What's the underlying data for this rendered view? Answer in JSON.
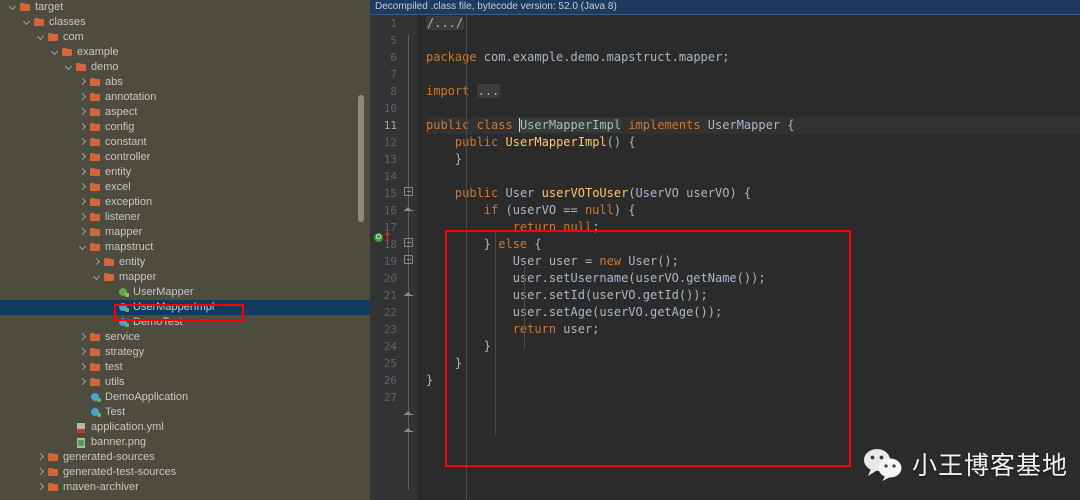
{
  "window": {
    "theme_bg_sidebar": "#4e4b3f",
    "theme_bg_editor": "#2b2b2b",
    "accent_red": "#ff0000",
    "selection_blue": "#123a5e"
  },
  "sidebar": {
    "name": "project-tree",
    "scrollbar_present": true,
    "items": [
      {
        "label": "target",
        "depth": 1,
        "type": "folder",
        "state": "expanded"
      },
      {
        "label": "classes",
        "depth": 2,
        "type": "folder",
        "state": "expanded"
      },
      {
        "label": "com",
        "depth": 3,
        "type": "folder",
        "state": "expanded"
      },
      {
        "label": "example",
        "depth": 4,
        "type": "folder",
        "state": "expanded"
      },
      {
        "label": "demo",
        "depth": 5,
        "type": "folder",
        "state": "expanded"
      },
      {
        "label": "abs",
        "depth": 6,
        "type": "folder",
        "state": "collapsed"
      },
      {
        "label": "annotation",
        "depth": 6,
        "type": "folder",
        "state": "collapsed"
      },
      {
        "label": "aspect",
        "depth": 6,
        "type": "folder",
        "state": "collapsed"
      },
      {
        "label": "config",
        "depth": 6,
        "type": "folder",
        "state": "collapsed"
      },
      {
        "label": "constant",
        "depth": 6,
        "type": "folder",
        "state": "collapsed"
      },
      {
        "label": "controller",
        "depth": 6,
        "type": "folder",
        "state": "collapsed"
      },
      {
        "label": "entity",
        "depth": 6,
        "type": "folder",
        "state": "collapsed"
      },
      {
        "label": "excel",
        "depth": 6,
        "type": "folder",
        "state": "collapsed"
      },
      {
        "label": "exception",
        "depth": 6,
        "type": "folder",
        "state": "collapsed"
      },
      {
        "label": "listener",
        "depth": 6,
        "type": "folder",
        "state": "collapsed"
      },
      {
        "label": "mapper",
        "depth": 6,
        "type": "folder",
        "state": "collapsed"
      },
      {
        "label": "mapstruct",
        "depth": 6,
        "type": "folder",
        "state": "expanded"
      },
      {
        "label": "entity",
        "depth": 7,
        "type": "folder",
        "state": "collapsed"
      },
      {
        "label": "mapper",
        "depth": 7,
        "type": "folder",
        "state": "expanded"
      },
      {
        "label": "UserMapper",
        "depth": 8,
        "type": "interface",
        "state": "none"
      },
      {
        "label": "UserMapperImpl",
        "depth": 8,
        "type": "class",
        "state": "none",
        "selected": true,
        "annotated": true
      },
      {
        "label": "DemoTest",
        "depth": 8,
        "type": "class",
        "state": "none"
      },
      {
        "label": "service",
        "depth": 6,
        "type": "folder",
        "state": "collapsed"
      },
      {
        "label": "strategy",
        "depth": 6,
        "type": "folder",
        "state": "collapsed"
      },
      {
        "label": "test",
        "depth": 6,
        "type": "folder",
        "state": "collapsed"
      },
      {
        "label": "utils",
        "depth": 6,
        "type": "folder",
        "state": "collapsed"
      },
      {
        "label": "DemoApplication",
        "depth": 6,
        "type": "class",
        "state": "none"
      },
      {
        "label": "Test",
        "depth": 6,
        "type": "class",
        "state": "none"
      },
      {
        "label": "application.yml",
        "depth": 5,
        "type": "yml",
        "state": "none"
      },
      {
        "label": "banner.png",
        "depth": 5,
        "type": "png",
        "state": "none"
      },
      {
        "label": "generated-sources",
        "depth": 3,
        "type": "folder",
        "state": "collapsed"
      },
      {
        "label": "generated-test-sources",
        "depth": 3,
        "type": "folder",
        "state": "collapsed"
      },
      {
        "label": "maven-archiver",
        "depth": 3,
        "type": "folder",
        "state": "collapsed"
      }
    ]
  },
  "editor": {
    "banner_text": "Decompiled .class file, bytecode version: 52.0 (Java 8)",
    "current_line_number": 11,
    "implementation_marker": "O",
    "lines": [
      {
        "num": "1",
        "html": "<span class=\"fold-chip\">/.../</span>"
      },
      {
        "num": "5",
        "html": ""
      },
      {
        "num": "6",
        "html": "<span class=\"kw\">package</span> com.example.demo.mapstruct.mapper;"
      },
      {
        "num": "7",
        "html": ""
      },
      {
        "num": "8",
        "html": "<span class=\"kw\">import</span> <span class=\"fold-chip\">...</span>"
      },
      {
        "num": "10",
        "html": ""
      },
      {
        "num": "11",
        "html": "<span class=\"kw\">public class</span> <span class=\"ident-hl\">UserMapperImpl</span> <span class=\"kw\">implements</span> UserMapper {",
        "current": true
      },
      {
        "num": "12",
        "html": "    <span class=\"kw\">public</span> <span class=\"mth\">UserMapperImpl</span>() {"
      },
      {
        "num": "13",
        "html": "    }"
      },
      {
        "num": "14",
        "html": ""
      },
      {
        "num": "15",
        "html": "    <span class=\"kw\">public</span> User <span class=\"mth\">userVOToUser</span>(UserVO userVO) {"
      },
      {
        "num": "16",
        "html": "        <span class=\"kw\">if</span> (userVO == <span class=\"kw\">null</span>) {"
      },
      {
        "num": "17",
        "html": "            <span class=\"kw\">return null</span>;"
      },
      {
        "num": "18",
        "html": "        } <span class=\"kw\">else</span> {"
      },
      {
        "num": "19",
        "html": "            User user = <span class=\"kw\">new</span> User();"
      },
      {
        "num": "20",
        "html": "            user.setUsername(userVO.getName());"
      },
      {
        "num": "21",
        "html": "            user.setId(userVO.getId());"
      },
      {
        "num": "22",
        "html": "            user.setAge(userVO.getAge());"
      },
      {
        "num": "23",
        "html": "            <span class=\"kw\">return</span> user;"
      },
      {
        "num": "24",
        "html": "        }"
      },
      {
        "num": "25",
        "html": "    }"
      },
      {
        "num": "26",
        "html": "}"
      },
      {
        "num": "27",
        "html": ""
      }
    ],
    "code_plain": [
      "/.../",
      "",
      "package com.example.demo.mapstruct.mapper;",
      "",
      "import ...",
      "",
      "public class UserMapperImpl implements UserMapper {",
      "    public UserMapperImpl() {",
      "    }",
      "",
      "    public User userVOToUser(UserVO userVO) {",
      "        if (userVO == null) {",
      "            return null;",
      "        } else {",
      "            User user = new User();",
      "            user.setUsername(userVO.getName());",
      "            user.setId(userVO.getId());",
      "            user.setAge(userVO.getAge());",
      "            return user;",
      "        }",
      "    }",
      "}",
      ""
    ]
  },
  "watermark": {
    "text": "小王博客基地",
    "icon": "wechat-icon"
  }
}
